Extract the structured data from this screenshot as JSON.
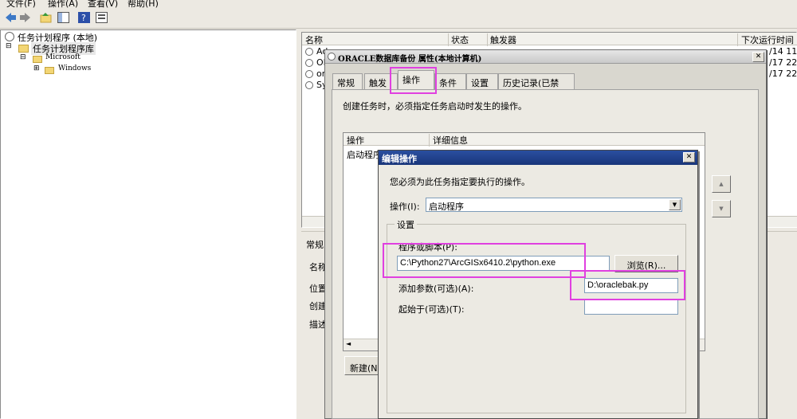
{
  "menu": {
    "items": [
      "文件(F)",
      "操作(A)",
      "查看(V)",
      "帮助(H)"
    ]
  },
  "tree": {
    "root": "任务计划程序 (本地)",
    "library": "任务计划程序库",
    "microsoft": "Microsoft",
    "windows": "Windows"
  },
  "task_list": {
    "columns": {
      "name": "名称",
      "status": "状态",
      "trigger": "触发器",
      "next_run": "下次运行时间"
    },
    "row_prefixes": [
      "Ad",
      "OR",
      "or",
      "Sy"
    ],
    "dates": [
      "/14 11:",
      "/17 22:",
      "/17 22:"
    ]
  },
  "lower_panel": {
    "tab": "常规",
    "labels": [
      "名称",
      "位置",
      "创建",
      "描述"
    ]
  },
  "props_dialog": {
    "title": "ORACLE数据库备份 属性(本地计算机)",
    "close": "✕",
    "tabs": [
      "常规",
      "触发器",
      "操作",
      "条件",
      "设置",
      "历史记录(已禁用)"
    ],
    "desc": "创建任务时，必须指定任务启动时发生的操作。",
    "list_headers": [
      "操作",
      "详细信息"
    ],
    "list_row": "启动程序",
    "new_button": "新建(N)...",
    "up": "▲",
    "down": "▼",
    "scroll_left": "◄"
  },
  "edit_dialog": {
    "title": "编辑操作",
    "close": "✕",
    "prompt": "您必须为此任务指定要执行的操作。",
    "action_label": "操作(I):",
    "action_value": "启动程序",
    "settings_group": "设置",
    "program_label": "程序或脚本(P):",
    "program_value": "C:\\Python27\\ArcGISx6410.2\\python.exe",
    "browse_button": "浏览(R)...",
    "args_label": "添加参数(可选)(A):",
    "args_value": "D:\\oraclebak.py",
    "start_in_label": "起始于(可选)(T):",
    "start_in_value": ""
  },
  "colors": {
    "highlight": "#e040e0",
    "title_active": "#1d3f8e",
    "title_inactive": "#7a96c8"
  }
}
